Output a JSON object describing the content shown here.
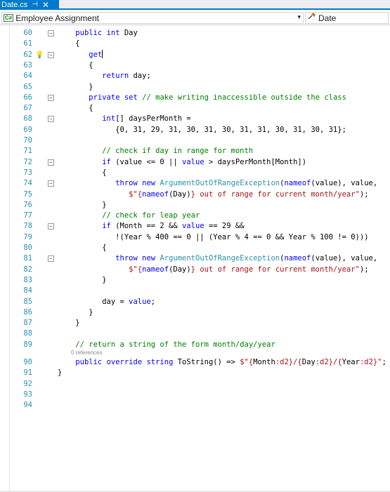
{
  "tab": {
    "filename": "Date.cs",
    "pin_glyph": "⊣",
    "close_glyph": "✕"
  },
  "navbar": {
    "project_badge": "C#",
    "project": "Employee Assignment",
    "dropdown_glyph": "▾",
    "member_icon": "property-icon",
    "member": "Date"
  },
  "codelens": "0 references",
  "code_lines": [
    {
      "num": "60",
      "html": "    <span class=\"kw\">public</span> <span class=\"kw\">int</span> Day"
    },
    {
      "num": "61",
      "html": "    {"
    },
    {
      "num": "62",
      "html": "       <span class=\"kw\">get</span><span class=\"caret\"></span>"
    },
    {
      "num": "63",
      "html": "       {"
    },
    {
      "num": "64",
      "html": "          <span class=\"kw\">return</span> day;"
    },
    {
      "num": "65",
      "html": "       }"
    },
    {
      "num": "66",
      "html": "       <span class=\"kw\">private</span> <span class=\"kw\">set</span> <span class=\"cm\">// make writing inaccessible outside the class</span>"
    },
    {
      "num": "67",
      "html": "       {"
    },
    {
      "num": "68",
      "html": "          <span class=\"kw\">int</span>[] daysPerMonth ="
    },
    {
      "num": "69",
      "html": "             {0, 31, 29, 31, 30, 31, 30, 31, 31, 30, 31, 30, 31};"
    },
    {
      "num": "70",
      "html": ""
    },
    {
      "num": "71",
      "html": "          <span class=\"cm\">// check if day in range for month</span>"
    },
    {
      "num": "72",
      "html": "          <span class=\"kw\">if</span> (value &lt;= 0 || <span class=\"kw\">value</span> &gt; daysPerMonth[Month])"
    },
    {
      "num": "73",
      "html": "          {"
    },
    {
      "num": "74",
      "html": "             <span class=\"kw\">throw</span> <span class=\"kw\">new</span> <span class=\"ty\">ArgumentOutOfRangeException</span>(<span class=\"kw\">nameof</span>(value), value,"
    },
    {
      "num": "75",
      "html": "                <span class=\"st\">$\"{</span><span class=\"kw\">nameof</span>(Day)<span class=\"st\">} out of range for current month/year\"</span>);"
    },
    {
      "num": "76",
      "html": "          }"
    },
    {
      "num": "77",
      "html": "          <span class=\"cm\">// check for leap year</span>"
    },
    {
      "num": "78",
      "html": "          <span class=\"kw\">if</span> (Month == 2 &amp;&amp; <span class=\"kw\">value</span> == 29 &amp;&amp;"
    },
    {
      "num": "79",
      "html": "             !(Year % 400 == 0 || (Year % 4 == 0 &amp;&amp; Year % 100 != 0)))"
    },
    {
      "num": "80",
      "html": "          {"
    },
    {
      "num": "81",
      "html": "             <span class=\"kw\">throw</span> <span class=\"kw\">new</span> <span class=\"ty\">ArgumentOutOfRangeException</span>(<span class=\"kw\">nameof</span>(value), value,"
    },
    {
      "num": "82",
      "html": "                <span class=\"st\">$\"{</span><span class=\"kw\">nameof</span>(Day)<span class=\"st\">} out of range for current month/year\"</span>);"
    },
    {
      "num": "83",
      "html": "          }"
    },
    {
      "num": "84",
      "html": ""
    },
    {
      "num": "85",
      "html": "          day = <span class=\"kw\">value</span>;"
    },
    {
      "num": "86",
      "html": "       }"
    },
    {
      "num": "87",
      "html": "    }"
    },
    {
      "num": "88",
      "html": ""
    },
    {
      "num": "89",
      "html": "    <span class=\"cm\">// return a string of the form month/day/year</span>"
    },
    {
      "num": "90",
      "html": "    <span class=\"kw\">public</span> <span class=\"kw\">override</span> <span class=\"kw\">string</span> ToString() =&gt; <span class=\"st\">$\"{</span>Month<span class=\"st\">:d2}/{</span>Day<span class=\"st\">:d2}/{</span>Year<span class=\"st\">:d2}\"</span>;"
    },
    {
      "num": "91",
      "html": "}"
    },
    {
      "num": "92",
      "html": ""
    },
    {
      "num": "93",
      "html": ""
    },
    {
      "num": "94",
      "html": ""
    }
  ],
  "colors": {
    "accent": "#007acc",
    "line_number": "#2b91af",
    "keyword": "#0000ff",
    "type": "#2b91af",
    "comment": "#008000",
    "string": "#a31515"
  }
}
